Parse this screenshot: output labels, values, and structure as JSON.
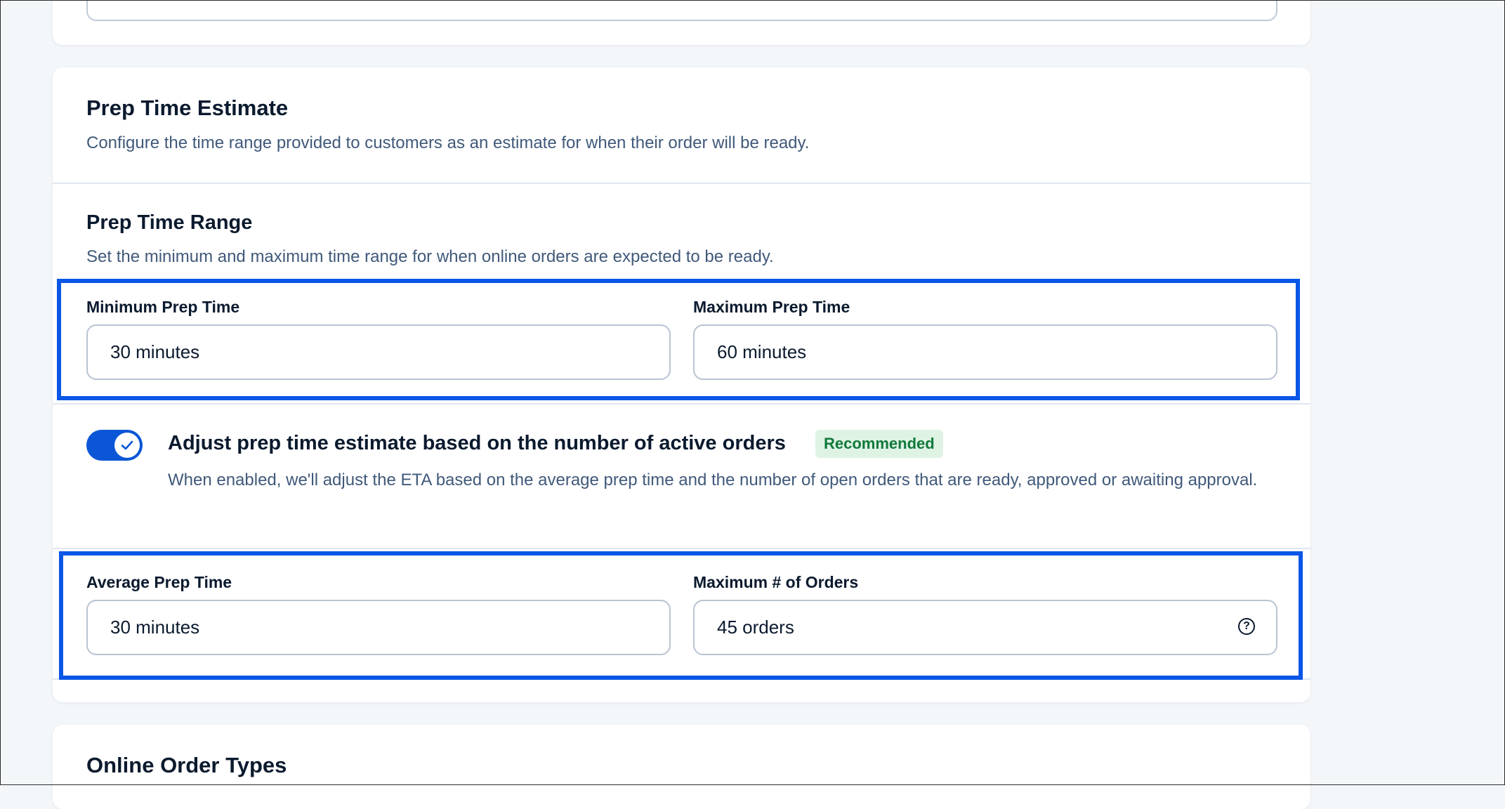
{
  "prep_time_estimate": {
    "title": "Prep Time Estimate",
    "description": "Configure the time range provided to customers as an estimate for when their order will be ready."
  },
  "prep_time_range": {
    "title": "Prep Time Range",
    "description": "Set the minimum and maximum time range for when online orders are expected to be ready.",
    "min_label": "Minimum Prep Time",
    "min_value": "30 minutes",
    "max_label": "Maximum Prep Time",
    "max_value": "60 minutes"
  },
  "adjust_toggle": {
    "enabled": true,
    "title": "Adjust prep time estimate based on the number of active orders",
    "badge": "Recommended",
    "description": "When enabled, we'll adjust the ETA based on the average prep time and the number of open orders that are ready, approved or awaiting approval."
  },
  "adjust_settings": {
    "avg_label": "Average Prep Time",
    "avg_value": "30 minutes",
    "max_orders_label": "Maximum # of Orders",
    "max_orders_value": "45 orders",
    "help_icon_glyph": "?"
  },
  "online_order_types": {
    "title": "Online Order Types"
  },
  "colors": {
    "accent_blue": "#0a56e6",
    "toggle_on": "#0a56d6",
    "badge_bg": "#dff3e5",
    "badge_text": "#10793a"
  }
}
